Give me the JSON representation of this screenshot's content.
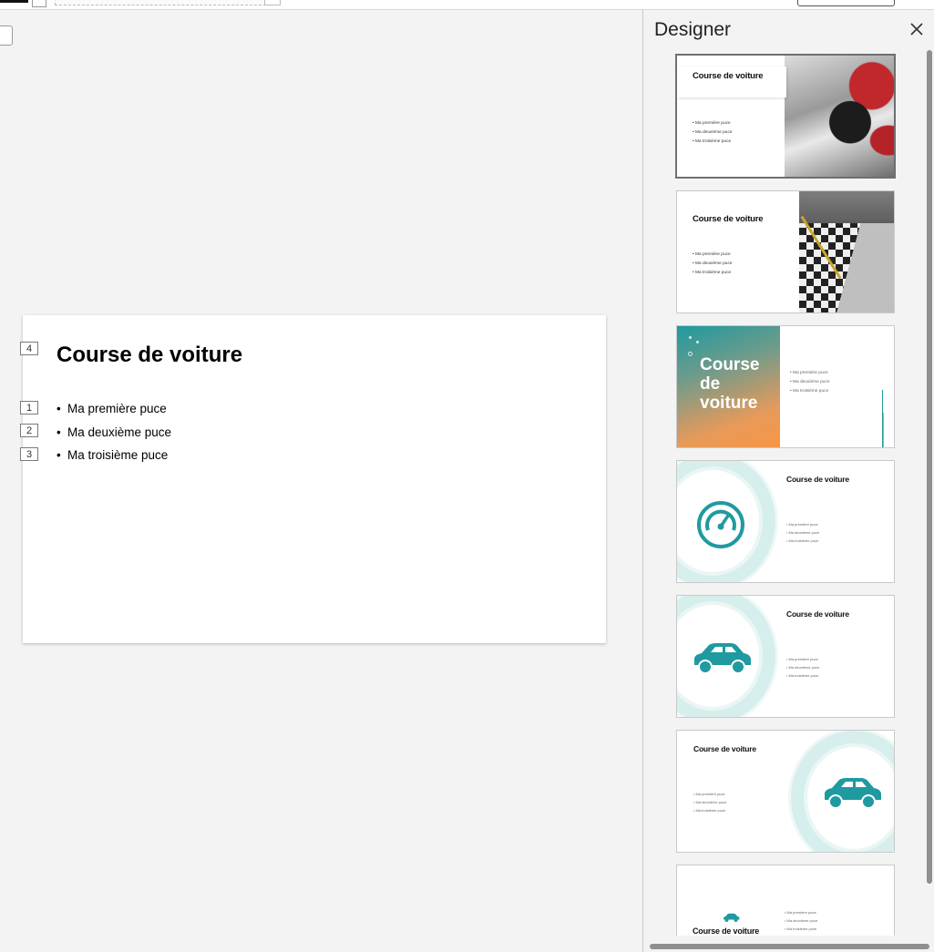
{
  "slide": {
    "title": "Course de voiture",
    "bullets": [
      "Ma première puce",
      "Ma deuxième puce",
      "Ma troisième puce"
    ],
    "placeholder_tags": {
      "title": "4",
      "bullet1": "1",
      "bullet2": "2",
      "bullet3": "3"
    },
    "bullet_char": "•"
  },
  "designer": {
    "title": "Designer",
    "close_icon": "close-icon",
    "thumbnails": [
      {
        "title": "Course de voiture",
        "bullets": [
          "Ma première puce",
          "Ma deuxième puce",
          "Ma troisième puce"
        ],
        "style": "photo-pit",
        "selected": true
      },
      {
        "title": "Course de voiture",
        "bullets": [
          "Ma première puce",
          "Ma deuxième puce",
          "Ma troisième puce"
        ],
        "style": "photo-checkered"
      },
      {
        "title": "Course de voiture",
        "bullets": [
          "Ma première puce",
          "Ma deuxième puce",
          "Ma troisième puce"
        ],
        "style": "gradient"
      },
      {
        "title": "Course de voiture",
        "bullets": [
          "Ma première puce",
          "Ma deuxième puce",
          "Ma troisième puce"
        ],
        "style": "speedometer-ring"
      },
      {
        "title": "Course de voiture",
        "bullets": [
          "Ma première puce",
          "Ma deuxième puce",
          "Ma troisième puce"
        ],
        "style": "car-ring-left"
      },
      {
        "title": "Course de voiture",
        "bullets": [
          "Ma première puce",
          "Ma deuxième puce",
          "Ma troisième puce"
        ],
        "style": "car-ring-right"
      },
      {
        "title": "Course de voiture",
        "bullets": [
          "Ma première puce",
          "Ma deuxième puce",
          "Ma troisième puce"
        ],
        "style": "car-small"
      }
    ]
  },
  "colors": {
    "accent_teal": "#1f9aa0",
    "accent_orange": "#f79646"
  }
}
